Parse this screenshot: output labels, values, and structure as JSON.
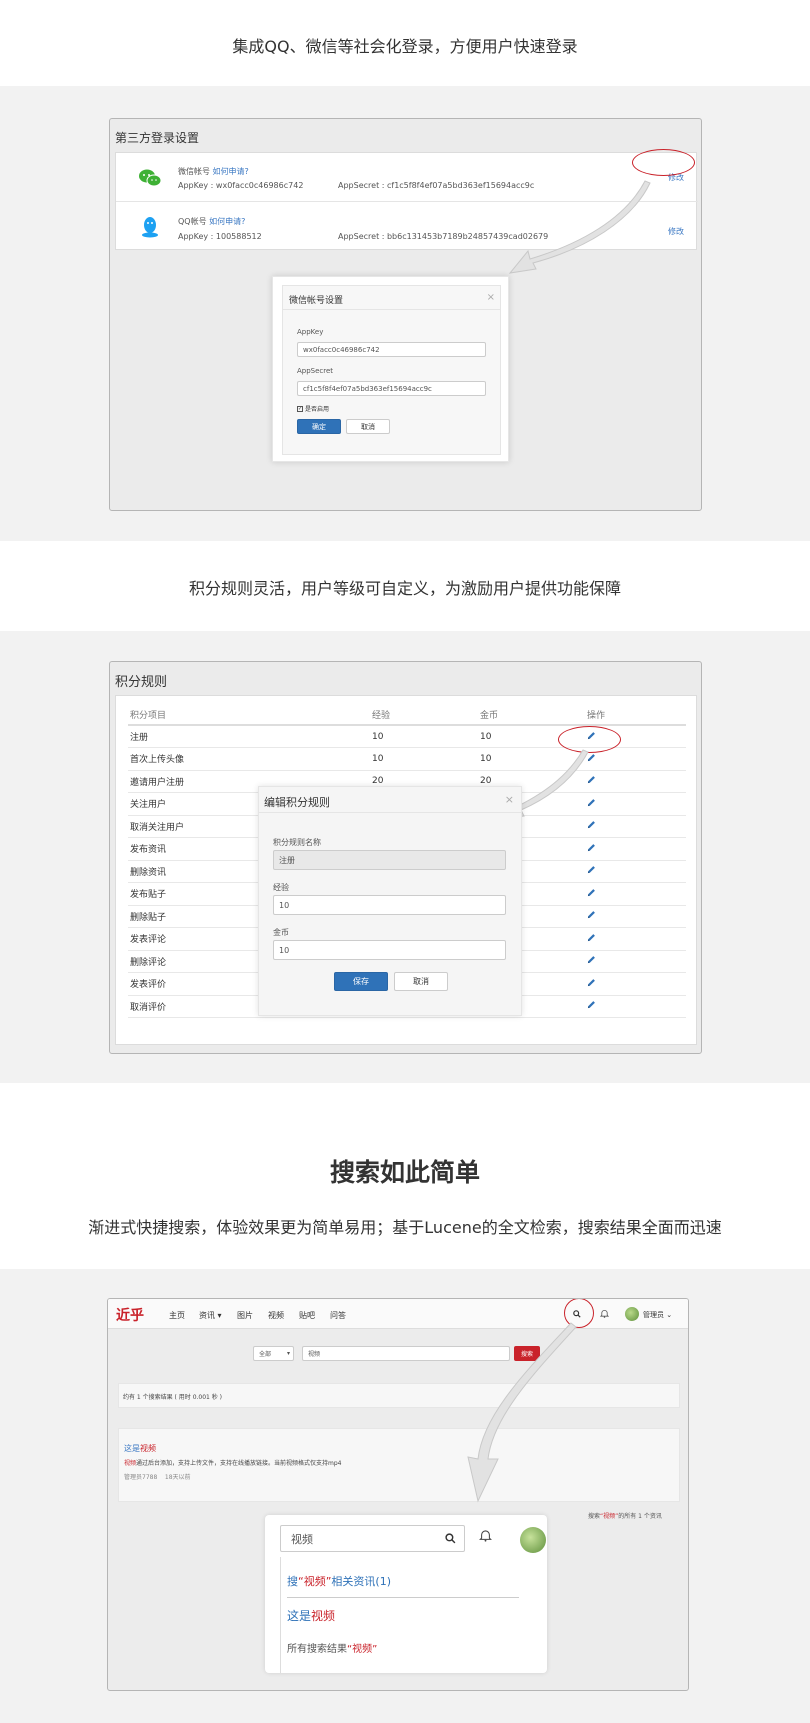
{
  "section1": {
    "caption": "集成QQ、微信等社会化登录，方便用户快速登录",
    "frame_title": "第三方登录设置",
    "accounts": [
      {
        "name": "微信帐号",
        "apply_link": "如何申请?",
        "appkey": "AppKey : wx0facc0c46986c742",
        "appsecret": "AppSecret : cf1c5f8f4ef07a5bd363ef15694acc9c",
        "action": "修改",
        "icon": "wechat-icon"
      },
      {
        "name": "QQ帐号",
        "apply_link": "如何申请?",
        "appkey": "AppKey : 100588512",
        "appsecret": "AppSecret : bb6c131453b7189b24857439cad02679",
        "action": "修改",
        "icon": "qq-icon"
      }
    ],
    "modal": {
      "title": "微信帐号设置",
      "close": "×",
      "appkey_label": "AppKey",
      "appkey_value": "wx0facc0c46986c742",
      "appsecret_label": "AppSecret",
      "appsecret_value": "cf1c5f8f4ef07a5bd363ef15694acc9c",
      "enabled_label": "是否启用",
      "enabled": true,
      "confirm": "确定",
      "cancel": "取消"
    }
  },
  "section2": {
    "caption": "积分规则灵活，用户等级可自定义，为激励用户提供功能保障",
    "frame_title": "积分规则",
    "columns": [
      "积分项目",
      "经验",
      "金币",
      "操作"
    ],
    "rows": [
      {
        "item": "注册",
        "exp": "10",
        "coin": "10"
      },
      {
        "item": "首次上传头像",
        "exp": "10",
        "coin": "10"
      },
      {
        "item": "邀请用户注册",
        "exp": "20",
        "coin": "20"
      },
      {
        "item": "关注用户",
        "exp": "",
        "coin": ""
      },
      {
        "item": "取消关注用户",
        "exp": "",
        "coin": ""
      },
      {
        "item": "发布资讯",
        "exp": "",
        "coin": ""
      },
      {
        "item": "删除资讯",
        "exp": "",
        "coin": ""
      },
      {
        "item": "发布贴子",
        "exp": "",
        "coin": ""
      },
      {
        "item": "删除贴子",
        "exp": "",
        "coin": ""
      },
      {
        "item": "发表评论",
        "exp": "",
        "coin": ""
      },
      {
        "item": "删除评论",
        "exp": "",
        "coin": ""
      },
      {
        "item": "发表评价",
        "exp": "",
        "coin": ""
      },
      {
        "item": "取消评价",
        "exp": "",
        "coin": ""
      }
    ],
    "modal": {
      "title": "编辑积分规则",
      "close": "×",
      "name_label": "积分规则名称",
      "name_value": "注册",
      "exp_label": "经验",
      "exp_value": "10",
      "coin_label": "金币",
      "coin_value": "10",
      "save": "保存",
      "cancel": "取消"
    }
  },
  "section3": {
    "heading": "搜索如此简单",
    "caption": "渐进式快捷搜索，体验效果更为简单易用；基于Lucene的全文检索，搜索结果全面而迅速",
    "logo": "近乎",
    "nav": [
      "主页",
      "资讯 ▾",
      "图片",
      "视频",
      "贴吧",
      "问答"
    ],
    "user": "管理员 ⌄",
    "search_scope": "全部",
    "search_value": "视频",
    "search_button": "搜索",
    "result_summary": "约有 1 个搜索结果 ( 用时 0.001 秒 )",
    "result": {
      "title_prefix": "这是",
      "title_hl": "视频",
      "desc_hl": "视频",
      "desc_rest": "通过后台添加，支持上传文件，支持在线播放链接。当前视频格式仅支持mp4",
      "meta": "管理员7788    18天以前"
    },
    "side_note_prefix": "搜索",
    "side_note_hl": "“视频”",
    "side_note_suffix": "的所有 1 个资讯",
    "popup": {
      "input_value": "视频",
      "suggest_prefix": "搜",
      "suggest_hl": "“视频”",
      "suggest_suffix": "相关资讯(1)",
      "item_prefix": "这是",
      "item_hl": "视频",
      "all_prefix": "所有搜索结果",
      "all_hl": "“视频”"
    }
  },
  "colors": {
    "accent": "#2f72b8",
    "highlight": "#c9222a",
    "band": "#f2f2f2"
  }
}
